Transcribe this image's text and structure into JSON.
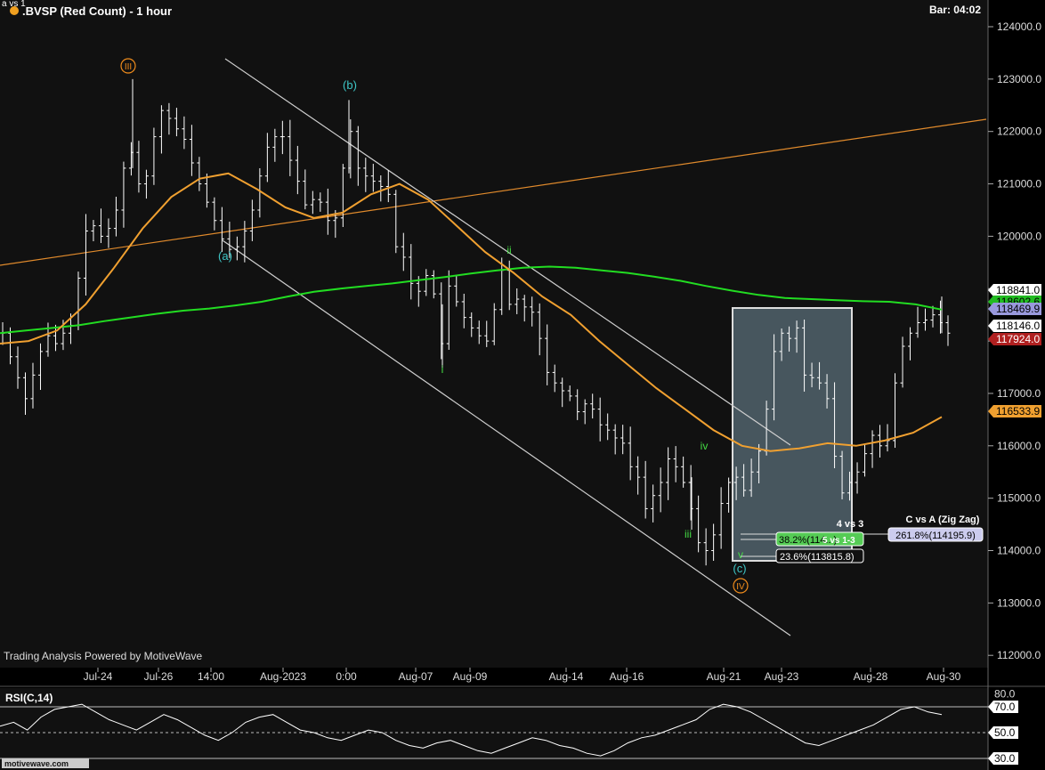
{
  "header": {
    "symbol_title": ".BVSP (Red Count) - 1 hour",
    "bar_timer": "Bar: 04:02",
    "corner_tag": "a vs 1"
  },
  "footer": {
    "powered_by": "Trading Analysis Powered by MotiveWave",
    "logo_text": "motivewave.com"
  },
  "colors": {
    "background": "#111111",
    "candle": "#ffffff",
    "green_ma": "#22dd22",
    "orange_ma": "#f0a030",
    "trendline_orange": "#e08a2c",
    "channel": "#cfcfcf",
    "wave_teal": "#3ec7c7",
    "wave_green": "#44dd44",
    "wave_orange": "#f08c1c",
    "box_fill": "#5a6e78",
    "price_tag_white": "#ffffff",
    "price_tag_red": "#b02020",
    "price_tag_orange": "#f0a030",
    "price_tag_lavender": "#9999dd"
  },
  "price_axis": {
    "labels": [
      "124000.0",
      "123000.0",
      "122000.0",
      "121000.0",
      "120000.0",
      "119000.0",
      "118000.0",
      "117000.0",
      "116000.0",
      "115000.0",
      "114000.0",
      "113000.0",
      "112000.0"
    ],
    "tags": [
      {
        "text": "118841.0",
        "style": "white"
      },
      {
        "text": "118602.6",
        "style": "green"
      },
      {
        "text": "118469.9",
        "style": "lavender"
      },
      {
        "text": "118146.0",
        "style": "white"
      },
      {
        "text": "117924.0",
        "style": "red"
      },
      {
        "text": "116533.9",
        "style": "orange"
      }
    ]
  },
  "time_axis": {
    "labels": [
      "Jul-24",
      "Jul-26",
      "14:00",
      "Aug-2023",
      "0:00",
      "Aug-07",
      "Aug-09",
      "Aug-14",
      "Aug-16",
      "Aug-21",
      "Aug-23",
      "Aug-28",
      "Aug-30"
    ]
  },
  "wave_labels": {
    "III": "III",
    "IV": "IV",
    "a": "(a)",
    "b": "(b)",
    "c": "(c)",
    "i": "i",
    "ii": "ii",
    "iii": "iii",
    "iv": "iv",
    "v": "v"
  },
  "fib": {
    "title_4vs3": "4 vs 3",
    "title_cvsa": "C vs A (Zig Zag)",
    "title_5vs1": "5 vs 1-3",
    "r382": "38.2%(114...)",
    "r236": "23.6%(113815.8)",
    "r2618": "261.8%(114195.9)"
  },
  "rsi": {
    "title": "RSI(C,14)",
    "axis_labels": [
      "80.0",
      "70.0",
      "50.0",
      "30.0"
    ]
  },
  "chart_data": {
    "type": "candlestick",
    "title": ".BVSP (Red Count) - 1 hour",
    "ylim": [
      112000,
      124200
    ],
    "x_categories": [
      "Jul-24",
      "Jul-26",
      "14:00",
      "Aug-2023",
      "0:00",
      "Aug-07",
      "Aug-09",
      "Aug-14",
      "Aug-16",
      "Aug-21",
      "Aug-23",
      "Aug-28",
      "Aug-30"
    ],
    "close_path": [
      118150,
      117700,
      117300,
      116900,
      117350,
      117800,
      118100,
      117950,
      118150,
      118300,
      119200,
      120100,
      120200,
      120000,
      120150,
      120500,
      121300,
      121600,
      121000,
      121150,
      121900,
      122400,
      122250,
      122050,
      121850,
      121400,
      121000,
      120650,
      120300,
      119950,
      119750,
      119800,
      120100,
      120500,
      121150,
      121700,
      121900,
      121900,
      121450,
      121050,
      120600,
      120700,
      120650,
      120300,
      120350,
      121300,
      122000,
      121300,
      121150,
      121050,
      120950,
      120800,
      119800,
      119600,
      119100,
      118950,
      119250,
      118900,
      117950,
      119050,
      118750,
      118450,
      118250,
      118100,
      118000,
      118600,
      119350,
      118700,
      118800,
      118650,
      118550,
      118050,
      117400,
      117200,
      117050,
      116950,
      116650,
      116800,
      116700,
      116400,
      116300,
      116150,
      116050,
      115600,
      115400,
      114800,
      115050,
      115300,
      115750,
      115600,
      115300,
      114800,
      114150,
      114000,
      114300,
      114900,
      115300,
      115400,
      115150,
      115500,
      115900,
      116700,
      117800,
      118150,
      118050,
      118250,
      117350,
      117300,
      117200,
      116900,
      115800,
      115100,
      115300,
      115500,
      115850,
      116200,
      116000,
      116100,
      117200,
      117900,
      118150,
      118350,
      118400,
      118500,
      118350,
      118150
    ],
    "series": [
      {
        "name": "green_ma",
        "values": [
          118150,
          118200,
          118250,
          118300,
          118380,
          118450,
          118520,
          118580,
          118620,
          118680,
          118750,
          118850,
          118940,
          119000,
          119050,
          119100,
          119160,
          119220,
          119290,
          119350,
          119400,
          119420,
          119400,
          119350,
          119300,
          119230,
          119150,
          119050,
          118960,
          118880,
          118820,
          118800,
          118780,
          118760,
          118750,
          118700,
          118600
        ]
      },
      {
        "name": "orange_ma",
        "values": [
          117950,
          118000,
          118200,
          118700,
          119400,
          120150,
          120750,
          121100,
          121200,
          120900,
          120550,
          120350,
          120450,
          120800,
          121000,
          120700,
          120200,
          119700,
          119300,
          118850,
          118500,
          118000,
          117550,
          117100,
          116700,
          116300,
          116000,
          115900,
          115950,
          116050,
          116000,
          116100,
          116250,
          116550
        ]
      }
    ],
    "levels": {
      "III": 123000,
      "IV": 113700,
      "a": 119850,
      "b": 122600,
      "c": 113700,
      "i": 117500,
      "ii": 119500,
      "iii": 114400,
      "iv": 115750,
      "v": 113800
    },
    "rsi_values": [
      55,
      58,
      52,
      62,
      68,
      70,
      72,
      66,
      60,
      56,
      52,
      58,
      64,
      60,
      54,
      48,
      44,
      50,
      58,
      62,
      64,
      58,
      52,
      50,
      46,
      44,
      48,
      52,
      50,
      44,
      40,
      38,
      42,
      44,
      40,
      36,
      34,
      38,
      42,
      46,
      44,
      40,
      38,
      34,
      32,
      36,
      42,
      46,
      48,
      52,
      56,
      60,
      68,
      72,
      70,
      66,
      60,
      54,
      48,
      42,
      40,
      44,
      48,
      52,
      56,
      62,
      68,
      70,
      66,
      64
    ]
  }
}
